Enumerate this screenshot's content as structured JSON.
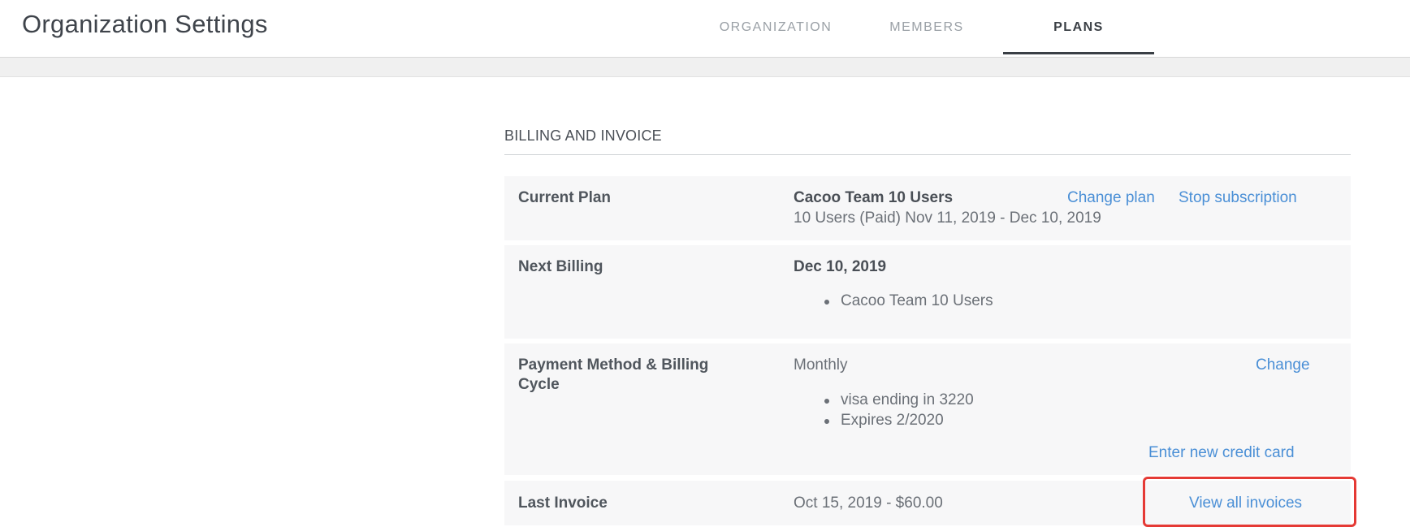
{
  "header": {
    "title": "Organization Settings",
    "tabs": [
      {
        "label": "ORGANIZATION",
        "active": false
      },
      {
        "label": "MEMBERS",
        "active": false
      },
      {
        "label": "PLANS",
        "active": true
      }
    ]
  },
  "billing": {
    "section_title": "BILLING AND INVOICE",
    "current_plan": {
      "label": "Current Plan",
      "plan_name": "Cacoo Team 10 Users",
      "details": "10 Users (Paid) Nov 11, 2019 - Dec 10, 2019",
      "change_link": "Change plan",
      "stop_link": "Stop subscription"
    },
    "next_billing": {
      "label": "Next Billing",
      "date": "Dec 10, 2019",
      "items": [
        "Cacoo Team 10 Users"
      ]
    },
    "payment": {
      "label_line1": "Payment Method & Billing",
      "label_line2": "Cycle",
      "cycle": "Monthly",
      "change_link": "Change",
      "items": [
        "visa ending in 3220",
        "Expires 2/2020"
      ],
      "new_card_link": "Enter new credit card"
    },
    "last_invoice": {
      "label": "Last Invoice",
      "value": "Oct 15, 2019 - $60.00",
      "view_all_link": "View all invoices"
    }
  },
  "colors": {
    "link": "#4a8fd6",
    "highlight": "#e53a35",
    "row_bg": "#f7f7f8"
  }
}
